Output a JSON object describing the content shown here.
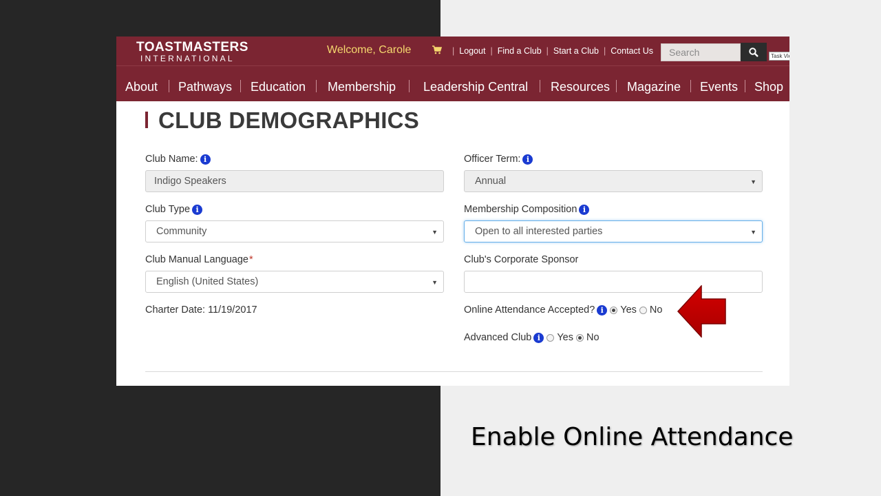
{
  "header": {
    "logo_line1": "TOASTMASTERS",
    "logo_line2": "INTERNATIONAL",
    "welcome": "Welcome, Carole",
    "links": [
      "Logout",
      "Find a Club",
      "Start a Club",
      "Contact Us"
    ],
    "search_placeholder": "Search",
    "taskview": "Task View"
  },
  "nav": [
    "About",
    "Pathways",
    "Education",
    "Membership",
    "Leadership Central",
    "Resources",
    "Magazine",
    "Events",
    "Shop"
  ],
  "page_title": "CLUB DEMOGRAPHICS",
  "form": {
    "club_name_label": "Club Name:",
    "club_name_value": "Indigo Speakers",
    "officer_term_label": "Officer Term:",
    "officer_term_value": "Annual",
    "club_type_label": "Club Type",
    "club_type_value": "Community",
    "membership_label": "Membership Composition",
    "membership_value": "Open to all interested parties",
    "language_label": "Club Manual Language",
    "language_required": "*",
    "language_value": "English (United States)",
    "sponsor_label": "Club's Corporate Sponsor",
    "sponsor_value": "",
    "charter_label": "Charter Date:",
    "charter_value": "11/19/2017",
    "online_label": "Online Attendance Accepted?",
    "online_yes": "Yes",
    "online_no": "No",
    "online_selected": "Yes",
    "advanced_label": "Advanced Club",
    "advanced_yes": "Yes",
    "advanced_no": "No",
    "advanced_selected": "No"
  },
  "caption": "Enable Online Attendance",
  "colors": {
    "brand": "#7b2532",
    "welcome": "#f5d76e",
    "info_icon": "#1a3bd1",
    "arrow": "#c00000"
  }
}
